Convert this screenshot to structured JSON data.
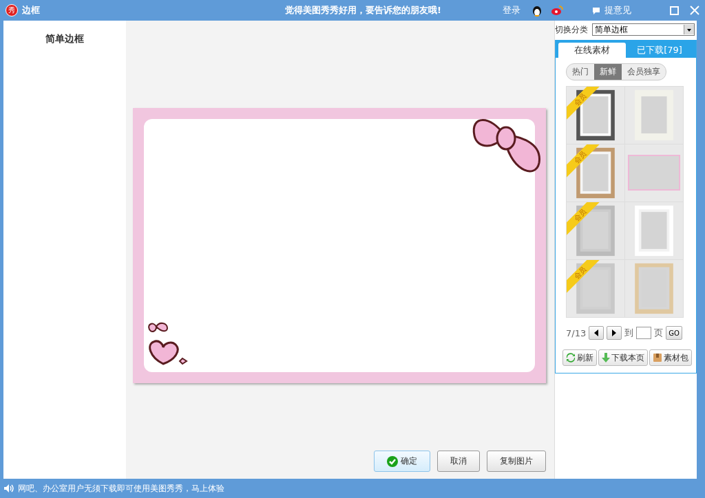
{
  "window": {
    "title": "边框",
    "slogan": "觉得美图秀秀好用，要告诉您的朋友哦!",
    "login": "登录",
    "feedback": "提意见",
    "logo_char": "秀"
  },
  "sidebar": {
    "title": "简单边框"
  },
  "category": {
    "label": "切换分类",
    "value": "简单边框"
  },
  "tabs": [
    {
      "label": "在线素材",
      "selected": true
    },
    {
      "label": "已下载[79]",
      "selected": false
    }
  ],
  "filters": [
    {
      "label": "热门",
      "selected": false
    },
    {
      "label": "新鲜",
      "selected": true
    },
    {
      "label": "会员独享",
      "selected": false
    }
  ],
  "thumbnails": [
    {
      "kind": "ornate",
      "badge": "会员"
    },
    {
      "kind": "polaroid"
    },
    {
      "kind": "bear",
      "badge": "会员"
    },
    {
      "kind": "pink"
    },
    {
      "kind": "rounded",
      "badge": "会员"
    },
    {
      "kind": "lace"
    },
    {
      "kind": "dashed",
      "badge": "会员"
    },
    {
      "kind": "wood"
    }
  ],
  "pager": {
    "current": "7/13",
    "goto_label": "到",
    "page_label": "页",
    "go": "GO"
  },
  "actions": [
    "刷新",
    "下载本页",
    "素材包"
  ],
  "buttons": [
    {
      "kind": "confirm",
      "label": "确定"
    },
    {
      "kind": "plain",
      "label": "取消"
    },
    {
      "kind": "plain",
      "label": "复制图片"
    }
  ],
  "status_bar": {
    "text": "网吧、办公室用户无须下载即可使用美图秀秀，马上体验"
  }
}
